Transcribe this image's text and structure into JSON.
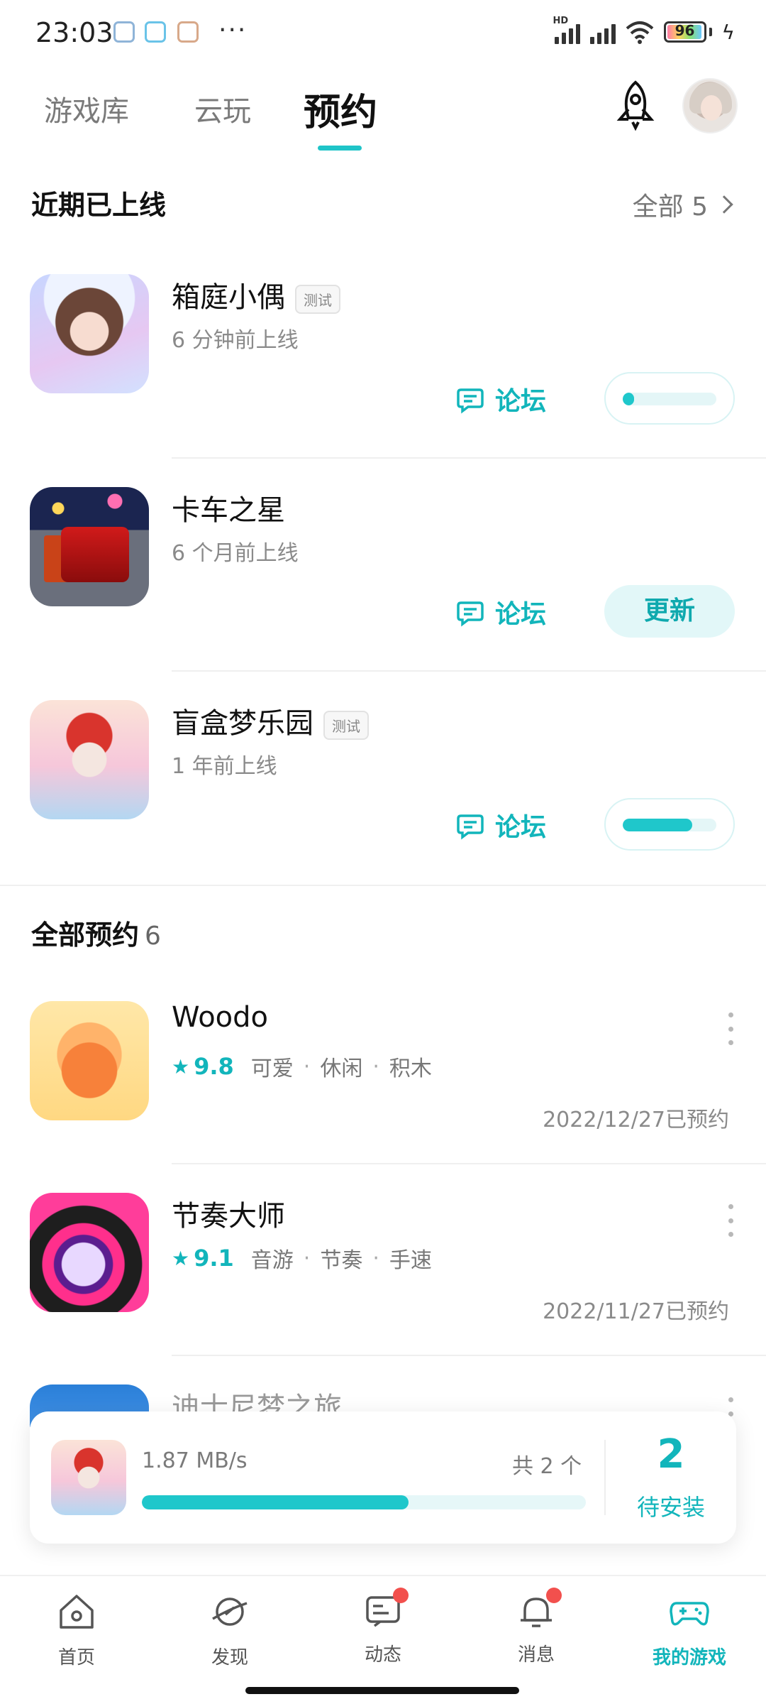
{
  "status_bar": {
    "time": "23:03",
    "dots": "···",
    "battery": "96"
  },
  "tabs": [
    {
      "label": "游戏库",
      "active": false
    },
    {
      "label": "云玩",
      "active": false
    },
    {
      "label": "预约",
      "active": true
    }
  ],
  "header_icons": [
    "rocket-icon",
    "avatar"
  ],
  "recent": {
    "title": "近期已上线",
    "see_all": "全部 5",
    "items": [
      {
        "name": "箱庭小偶",
        "badge": "测试",
        "subtitle": "6 分钟前上线",
        "forum": "论坛",
        "action": "progress",
        "progress": 0.12
      },
      {
        "name": "卡车之星",
        "badge": "",
        "subtitle": "6 个月前上线",
        "forum": "论坛",
        "action": "更新"
      },
      {
        "name": "盲盒梦乐园",
        "badge": "测试",
        "subtitle": "1 年前上线",
        "forum": "论坛",
        "action": "progress",
        "progress": 0.74
      }
    ]
  },
  "reservations": {
    "title": "全部预约",
    "count": "6",
    "items": [
      {
        "name": "Woodo",
        "rating": "9.8",
        "tags": [
          "可爱",
          "休闲",
          "积木"
        ],
        "date": "2022/12/27已预约"
      },
      {
        "name": "节奏大师",
        "rating": "9.1",
        "tags": [
          "音游",
          "节奏",
          "手速"
        ],
        "date": "2022/11/27已预约"
      },
      {
        "name": "迪士尼梦之旅"
      }
    ]
  },
  "download": {
    "speed": "1.87 MB/s",
    "total": "共 2 个",
    "progress": 0.6,
    "pending_count": "2",
    "pending_label": "待安装"
  },
  "bottom_nav": [
    {
      "label": "首页",
      "icon": "home-icon",
      "active": false,
      "dot": false
    },
    {
      "label": "发现",
      "icon": "discover-icon",
      "active": false,
      "dot": false
    },
    {
      "label": "动态",
      "icon": "feed-icon",
      "active": false,
      "dot": true
    },
    {
      "label": "消息",
      "icon": "bell-icon",
      "active": false,
      "dot": true
    },
    {
      "label": "我的游戏",
      "icon": "gamepad-icon",
      "active": true,
      "dot": false
    }
  ],
  "colors": {
    "accent": "#1fc7cb",
    "accent_text": "#12b5bb",
    "notification": "#f2504d"
  }
}
